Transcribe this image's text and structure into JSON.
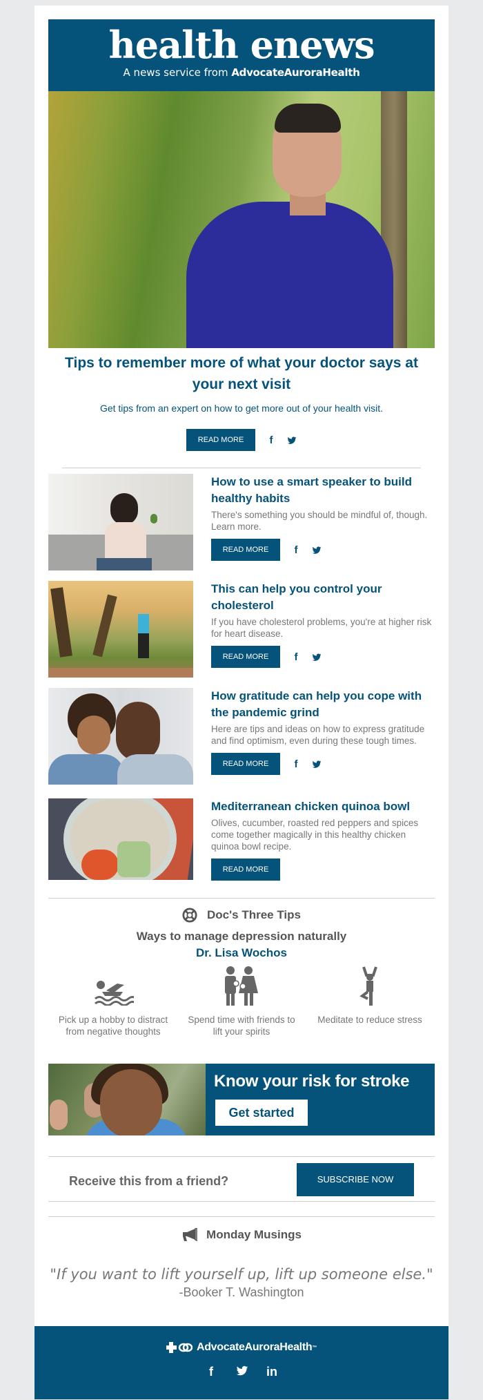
{
  "masthead": {
    "logo": "health enews",
    "tagline_prefix": "A news service from ",
    "tagline_brand": "AdvocateAuroraHealth"
  },
  "hero": {
    "image_alt": "man-breathing-outdoors-photo",
    "title": "Tips to remember more of what your doctor says at your next visit",
    "description": "Get tips from an expert on how to get more out of your health visit.",
    "read_more": "READ MORE"
  },
  "articles": [
    {
      "title": "How to use a smart speaker to build healthy habits",
      "description": "There's something you should be mindful of, though. Learn more.",
      "read_more": "READ MORE",
      "has_social": true
    },
    {
      "title": "This can help you control your cholesterol",
      "description": "If you have cholesterol problems, you're at higher risk for heart disease.",
      "read_more": "READ MORE",
      "has_social": true
    },
    {
      "title": "How gratitude can help you cope with the pandemic grind",
      "description": "Here are tips and ideas on how to express gratitude and find optimism, even during these tough times.",
      "read_more": "READ MORE",
      "has_social": true
    },
    {
      "title": "Mediterranean chicken quinoa bowl",
      "description": "Olives, cucumber, roasted red peppers and spices come together magically in this healthy chicken quinoa bowl recipe.",
      "read_more": "READ MORE",
      "has_social": false
    }
  ],
  "docs_tips": {
    "heading": "Doc's Three Tips",
    "subtitle": "Ways to manage depression naturally",
    "doctor": "Dr. Lisa Wochos",
    "tips": [
      {
        "icon": "swimmer-icon",
        "text": "Pick up a hobby to distract from negative thoughts"
      },
      {
        "icon": "family-icon",
        "text": "Spend time with friends to lift your spirits"
      },
      {
        "icon": "yoga-pose-icon",
        "text": "Meditate to reduce stress"
      }
    ]
  },
  "banner": {
    "headline": "Know your risk for stroke",
    "cta": "Get started"
  },
  "subscribe": {
    "question": "Receive this from a friend?",
    "button": "SUBSCRIBE NOW"
  },
  "musings": {
    "heading": "Monday Musings",
    "quote": "\"If you want to lift yourself up, lift up someone else.\"",
    "author": "-Booker T. Washington"
  },
  "footer": {
    "brand": "AdvocateAuroraHealth",
    "trademark": "™",
    "social": [
      "facebook",
      "twitter",
      "linkedin"
    ]
  },
  "colors": {
    "brand_blue": "#05537b",
    "page_bg": "#e9eaec",
    "body_gray": "#777777"
  }
}
